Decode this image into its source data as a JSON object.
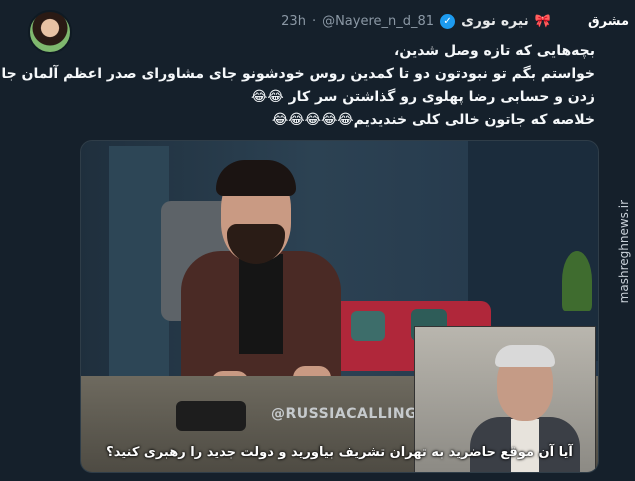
{
  "header": {
    "display_name": "نیره نوری",
    "bow_emoji": "🎀",
    "handle": "@Nayere_n_d_81",
    "separator": "·",
    "time": "23h"
  },
  "tweet": {
    "lines": [
      "بچه‌هایی که تازه وصل شدین،",
      "خواستم بگم تو نبودتون دو تا کمدین روس خودشونو جای مشاورای صدر اعظم آلمان جا",
      "زدن و حسابی رضا پهلوی رو گذاشتن سر کار 😂😂",
      "خلاصه که جاتون خالی کلی خندیدیم😂😂😂😂😂"
    ]
  },
  "video": {
    "watermark": "@RUSSIACALLING",
    "subtitle_line1": "آیا آن موقع حاضرید به تهران تشریف بیاورید و دولت جدید را رهبری کنید؟"
  },
  "branding": {
    "logo_text": "مشرق",
    "side_site": "mashreghnews.ir"
  },
  "colors": {
    "background": "#15202b",
    "verified": "#1d9bf0",
    "muted": "#8b98a5"
  }
}
